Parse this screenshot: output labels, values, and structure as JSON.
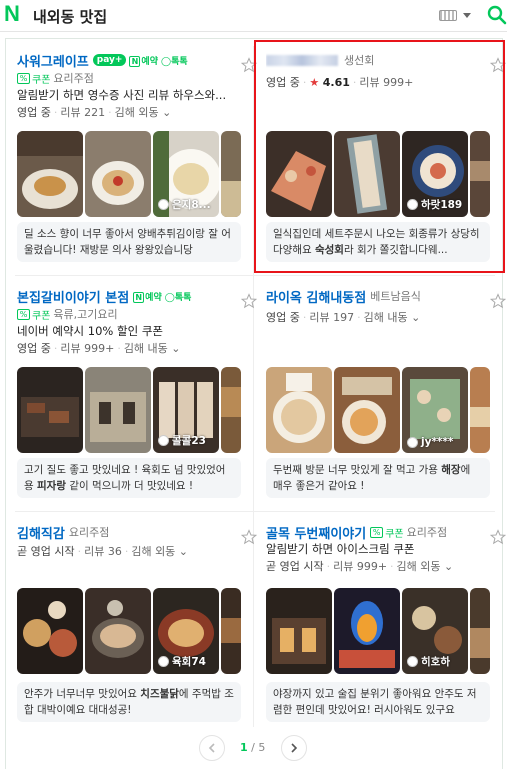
{
  "header": {
    "title": "내외동 맛집"
  },
  "cards": [
    {
      "name": "사워그레이프",
      "category": "요리주점",
      "badges": {
        "pay": "pay+",
        "reserve": "예약",
        "talk": "톡톡"
      },
      "coupon": "쿠폰",
      "promo": "알림받기 하면 영수증 사진 리뷰 하우스와...",
      "status": "영업 중",
      "reviews": "리뷰 221",
      "location": "김해 외동",
      "photo_tag": "은지8...",
      "review": "딜 소스 향이 너무 좋아서 양배추튀김이랑 잘 어울렸습니다! 재방문 의사 왕왕있습니당"
    },
    {
      "name": "",
      "category": "생선회",
      "status": "영업 중",
      "rating": "4.61",
      "reviews": "리뷰 999+",
      "photo_tag": "하랏189",
      "review_pre": "일식집인데 세트주문시 나오는 회종류가 상당히 다양해요 ",
      "review_bold": "숙성회",
      "review_post": "라 회가 쫄깃합니다웨..."
    },
    {
      "name": "본집갈비이야기 본점",
      "category": "육류,고기요리",
      "badges": {
        "reserve": "예약",
        "talk": "톡톡"
      },
      "coupon": "쿠폰",
      "promo": "네이버 예약시 10% 할인 쿠폰",
      "status": "영업 중",
      "reviews": "리뷰 999+",
      "location": "김해 내동",
      "photo_tag": "콜콜23",
      "review_pre": "고기 질도 좋고 맛있네요 ! 육회도 넘 맛있었어용 ",
      "review_bold": "피자랑",
      "review_post": " 같이 먹으니까 더 맛있네요 !"
    },
    {
      "name": "라이옥 김해내동점",
      "category": "베트남음식",
      "status": "영업 중",
      "reviews": "리뷰 197",
      "location": "김해 내동",
      "photo_tag": "jy****",
      "review_pre": "두번째 방문 너무 맛있게 잘 먹고 가용 ",
      "review_bold": "해장",
      "review_post": "에 매우 좋은거 같아요 !"
    },
    {
      "name": "김해직감",
      "category": "요리주점",
      "status": "곧 영업 시작",
      "reviews": "리뷰 36",
      "location": "김해 외동",
      "photo_tag": "육회74",
      "review_pre": "안주가 너무너무 맛있어요 ",
      "review_bold": "치즈불닭",
      "review_post": "에 주먹밥 조합 대박이예요 대대성공!"
    },
    {
      "name": "골목 두번째이야기",
      "category": "요리주점",
      "coupon": "쿠폰",
      "promo": "알림받기 하면 아이스크림 쿠폰",
      "status": "곧 영업 시작",
      "reviews": "리뷰 999+",
      "location": "김해 외동",
      "photo_tag": "히호하",
      "review": "야장까지 있고 술집 분위기 좋아워요 안주도 저렴한 편인데 맛있어요! 러시아워도 있구요"
    }
  ],
  "pager": {
    "current": "1",
    "total": "/ 5"
  },
  "colors": {
    "brand": "#03c75a",
    "link": "#0068c3",
    "highlight": "#e8141a",
    "star": "#e23b3b"
  }
}
